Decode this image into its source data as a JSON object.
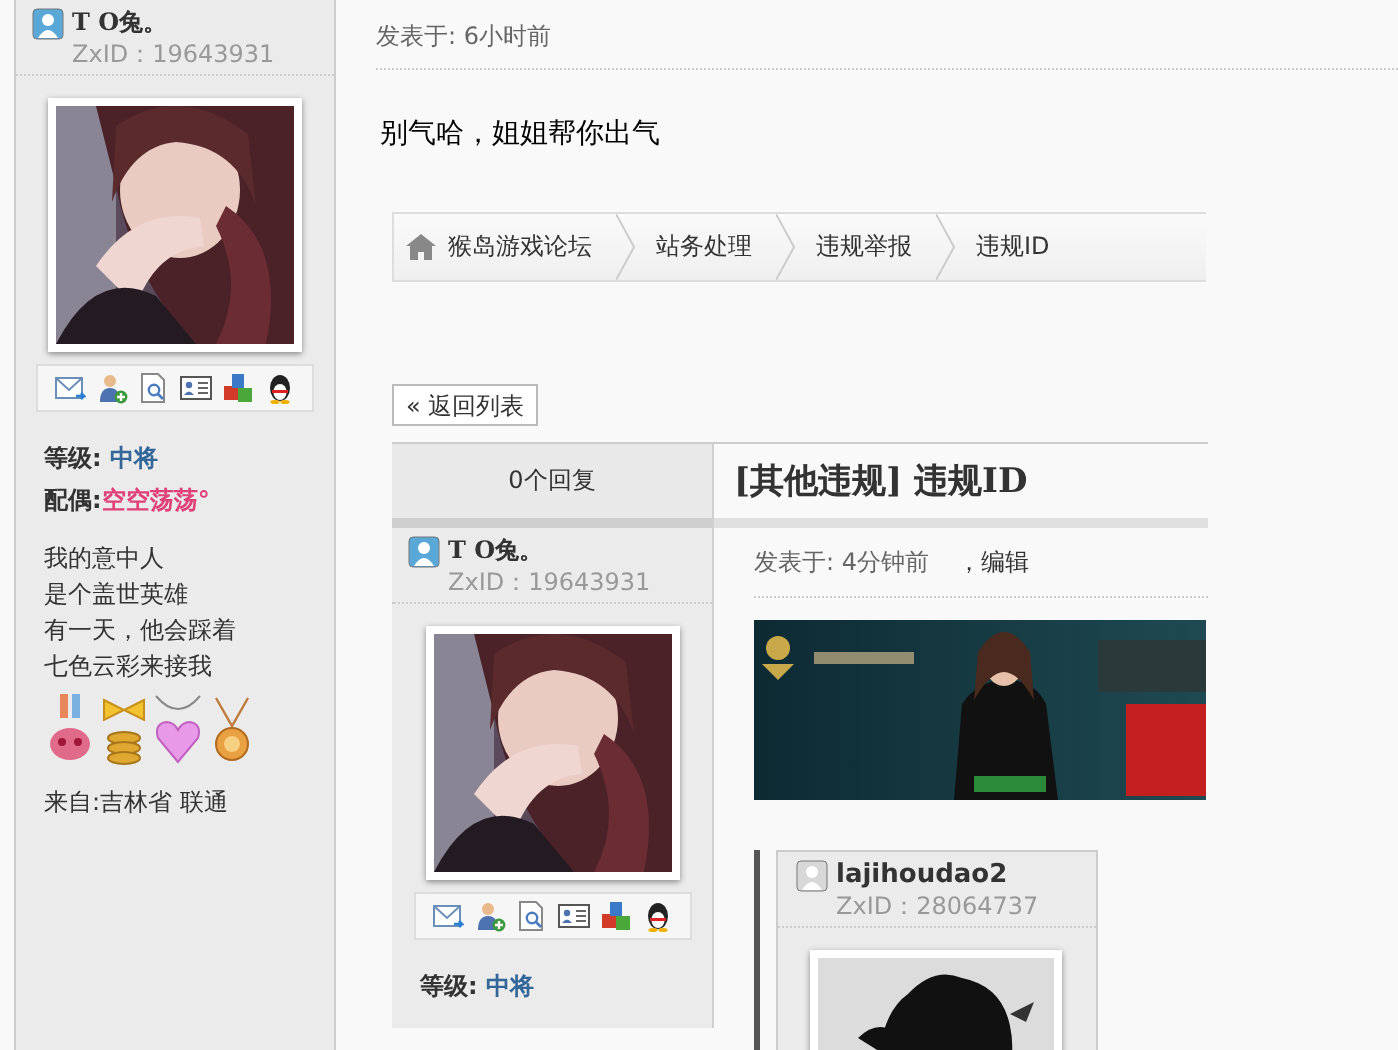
{
  "sidebar_user": {
    "name": "T O兔。",
    "zxid": "ZxID：19643931",
    "rank_label": "等级:",
    "rank": "中将",
    "spouse_label": "配偶:",
    "spouse": "空空荡荡°",
    "signature": [
      "我的意中人",
      "是个盖世英雄",
      "有一天，他会踩着",
      "七色云彩来接我"
    ],
    "location": "来自:吉林省 联通"
  },
  "post": {
    "time": "发表于: 6小时前",
    "message": "别气哈，姐姐帮你出气"
  },
  "breadcrumb": [
    {
      "label": "猴岛游戏论坛"
    },
    {
      "label": "站务处理"
    },
    {
      "label": "违规举报"
    },
    {
      "label": "违规ID"
    }
  ],
  "back_button": "« 返回列表",
  "thread": {
    "reply_count": "0个回复",
    "title": "[其他违规] 违规ID",
    "author": {
      "name": "T O兔。",
      "zxid": "ZxID：19643931",
      "rank_label": "等级:",
      "rank": "中将"
    },
    "time": "发表于: 4分钟前",
    "edit_link": "，编辑",
    "quote": {
      "name": "lajihoudao2",
      "zxid": "ZxID：28064737"
    }
  }
}
